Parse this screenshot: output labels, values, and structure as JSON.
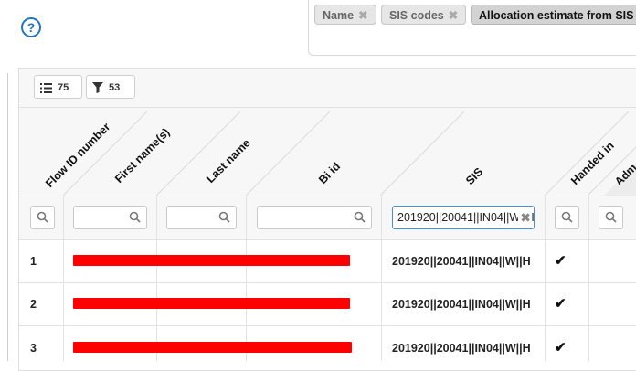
{
  "help": {
    "glyph": "?"
  },
  "chips": [
    {
      "label": "Name",
      "close": "✖"
    },
    {
      "label": "SIS codes",
      "close": "✖"
    },
    {
      "label": "Allocation estimate from SIS"
    }
  ],
  "toolbar": {
    "columns_count": "75",
    "filters_count": "53"
  },
  "columns": {
    "flow_id": "Flow ID number",
    "first_name": "First name(s)",
    "last_name": "Last name",
    "bi_id": "Bi id",
    "sis": "SIS",
    "handed_in": "Handed in",
    "partial": "Adm"
  },
  "filter": {
    "sis_value": "201920||20041||IN04||W||H",
    "clear": "✖"
  },
  "rows": [
    {
      "id": "1",
      "sis": "201920||20041||IN04||W||H",
      "handed_in": "✔"
    },
    {
      "id": "2",
      "sis": "201920||20041||IN04||W||H",
      "handed_in": "✔"
    },
    {
      "id": "3",
      "sis": "201920||20041||IN04||W||H",
      "handed_in": "✔"
    }
  ],
  "colors": {
    "accent": "#1f73c7",
    "redaction": "#ff0000",
    "active_input": "#4a90d9"
  }
}
